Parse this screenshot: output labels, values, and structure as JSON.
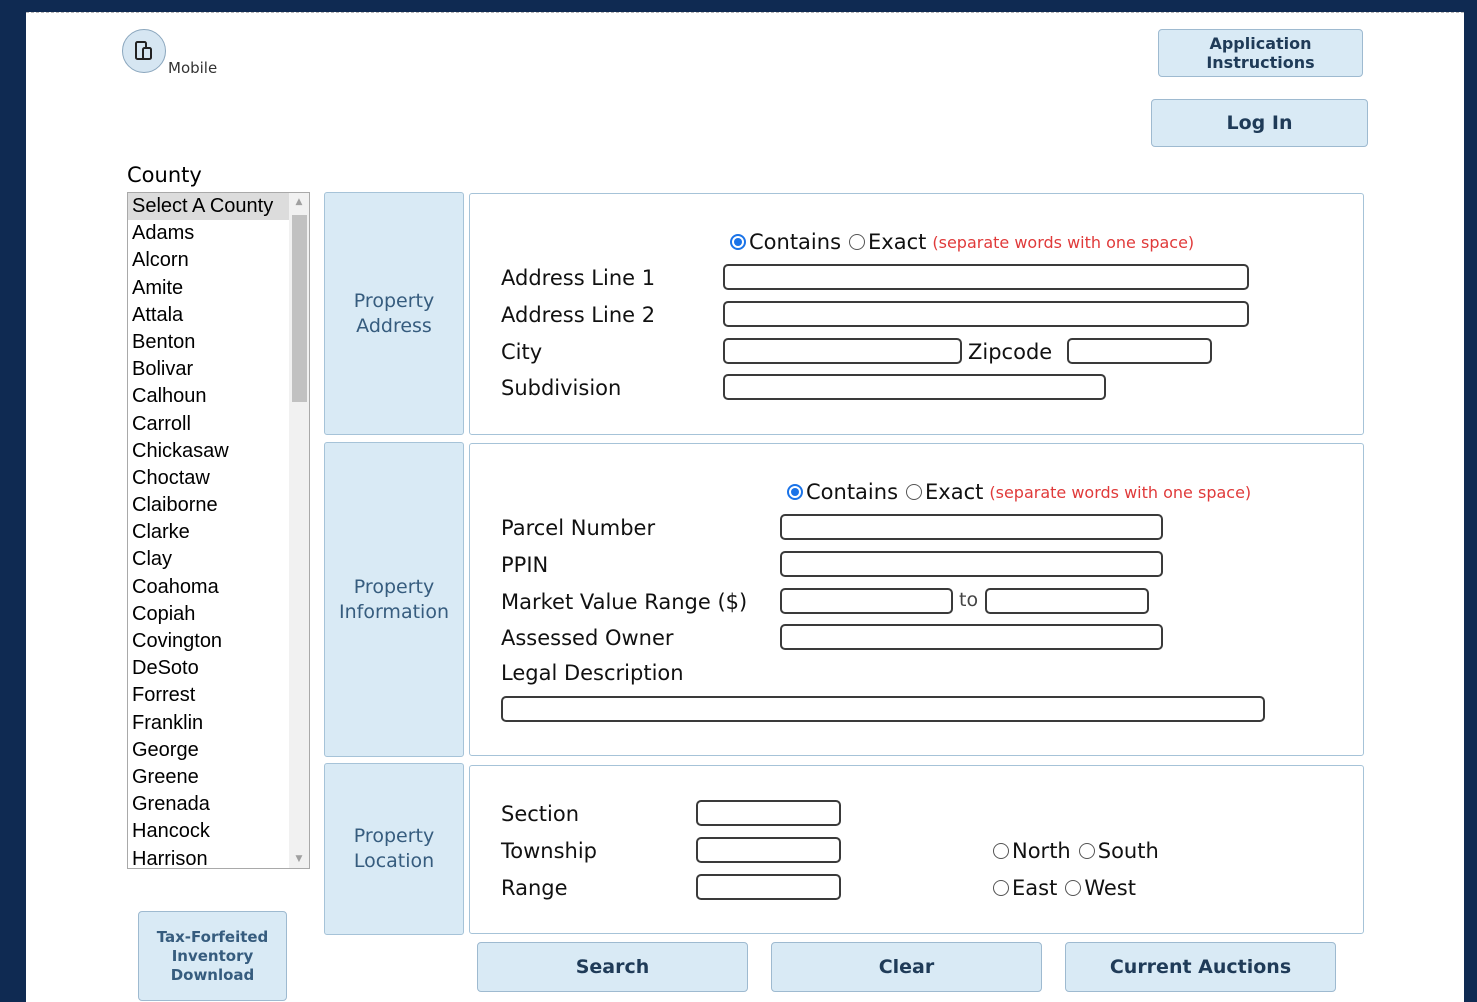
{
  "mobile": {
    "label": "Mobile",
    "icon": "mobile-devices-icon"
  },
  "header": {
    "app_instructions_label": "Application Instructions",
    "login_label": "Log In"
  },
  "county": {
    "title": "County",
    "selected": "Select A County",
    "options": [
      "Select A County",
      "Adams",
      "Alcorn",
      "Amite",
      "Attala",
      "Benton",
      "Bolivar",
      "Calhoun",
      "Carroll",
      "Chickasaw",
      "Choctaw",
      "Claiborne",
      "Clarke",
      "Clay",
      "Coahoma",
      "Copiah",
      "Covington",
      "DeSoto",
      "Forrest",
      "Franklin",
      "George",
      "Greene",
      "Grenada",
      "Hancock",
      "Harrison"
    ]
  },
  "inventory_download_label": "Tax-Forfeited Inventory Download",
  "address": {
    "section_label": "Property Address",
    "match_contains": "Contains",
    "match_exact": "Exact",
    "match_note": "(separate words with one space)",
    "address1_label": "Address Line 1",
    "address2_label": "Address Line 2",
    "city_label": "City",
    "zipcode_label": "Zipcode",
    "subdivision_label": "Subdivision"
  },
  "info": {
    "section_label": "Property Information",
    "match_contains": "Contains",
    "match_exact": "Exact",
    "match_note": "(separate words with one space)",
    "parcel_label": "Parcel Number",
    "ppin_label": "PPIN",
    "market_label": "Market Value Range ($)",
    "to_label": "to",
    "owner_label": "Assessed Owner",
    "legal_label": "Legal Description"
  },
  "location": {
    "section_label": "Property Location",
    "section_field_label": "Section",
    "township_label": "Township",
    "range_label": "Range",
    "north": "North",
    "south": "South",
    "east": "East",
    "west": "West"
  },
  "actions": {
    "search": "Search",
    "clear": "Clear",
    "auctions": "Current Auctions"
  },
  "colors": {
    "frame": "#0f2a52",
    "button_bg": "#d9eaf5",
    "note_red": "#e03a3a",
    "radio_blue": "#1a73e8"
  }
}
